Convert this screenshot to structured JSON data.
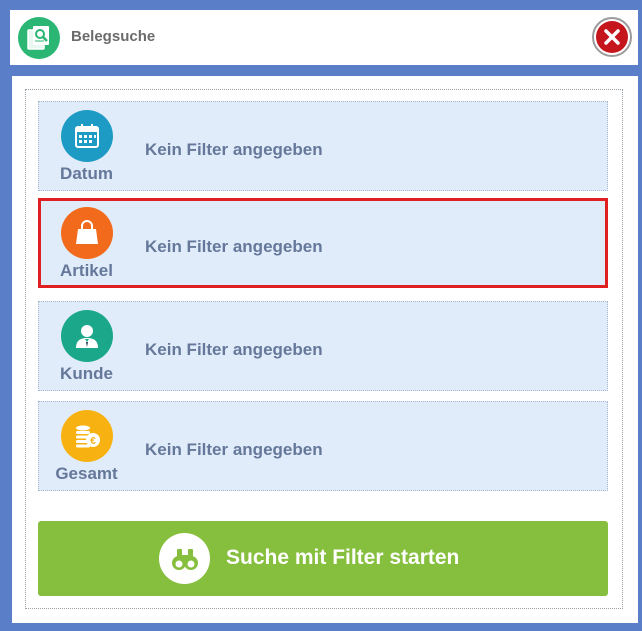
{
  "window": {
    "title": "Belegsuche",
    "app_icon": "document-search-icon",
    "close_icon": "close-icon"
  },
  "filters": [
    {
      "label": "Datum",
      "icon": "calendar-icon",
      "text": "Kein Filter angegeben",
      "icon_color": "#1e9bc4",
      "selected": false
    },
    {
      "label": "Artikel",
      "icon": "shopping-bag-icon",
      "text": "Kein Filter angegeben",
      "icon_color": "#f26a1b",
      "selected": true
    },
    {
      "label": "Kunde",
      "icon": "person-icon",
      "text": "Kein Filter angegeben",
      "icon_color": "#1ba88a",
      "selected": false
    },
    {
      "label": "Gesamt",
      "icon": "coins-euro-icon",
      "text": "Kein Filter angegeben",
      "icon_color": "#f7b212",
      "selected": false
    }
  ],
  "start_button": {
    "label": "Suche mit Filter starten",
    "icon": "binoculars-icon",
    "color": "#86bf3e"
  },
  "colors": {
    "frame": "#5b7ec9",
    "row_bg": "#e1ecfb",
    "selection_border": "#e02020",
    "text": "#65789a"
  }
}
